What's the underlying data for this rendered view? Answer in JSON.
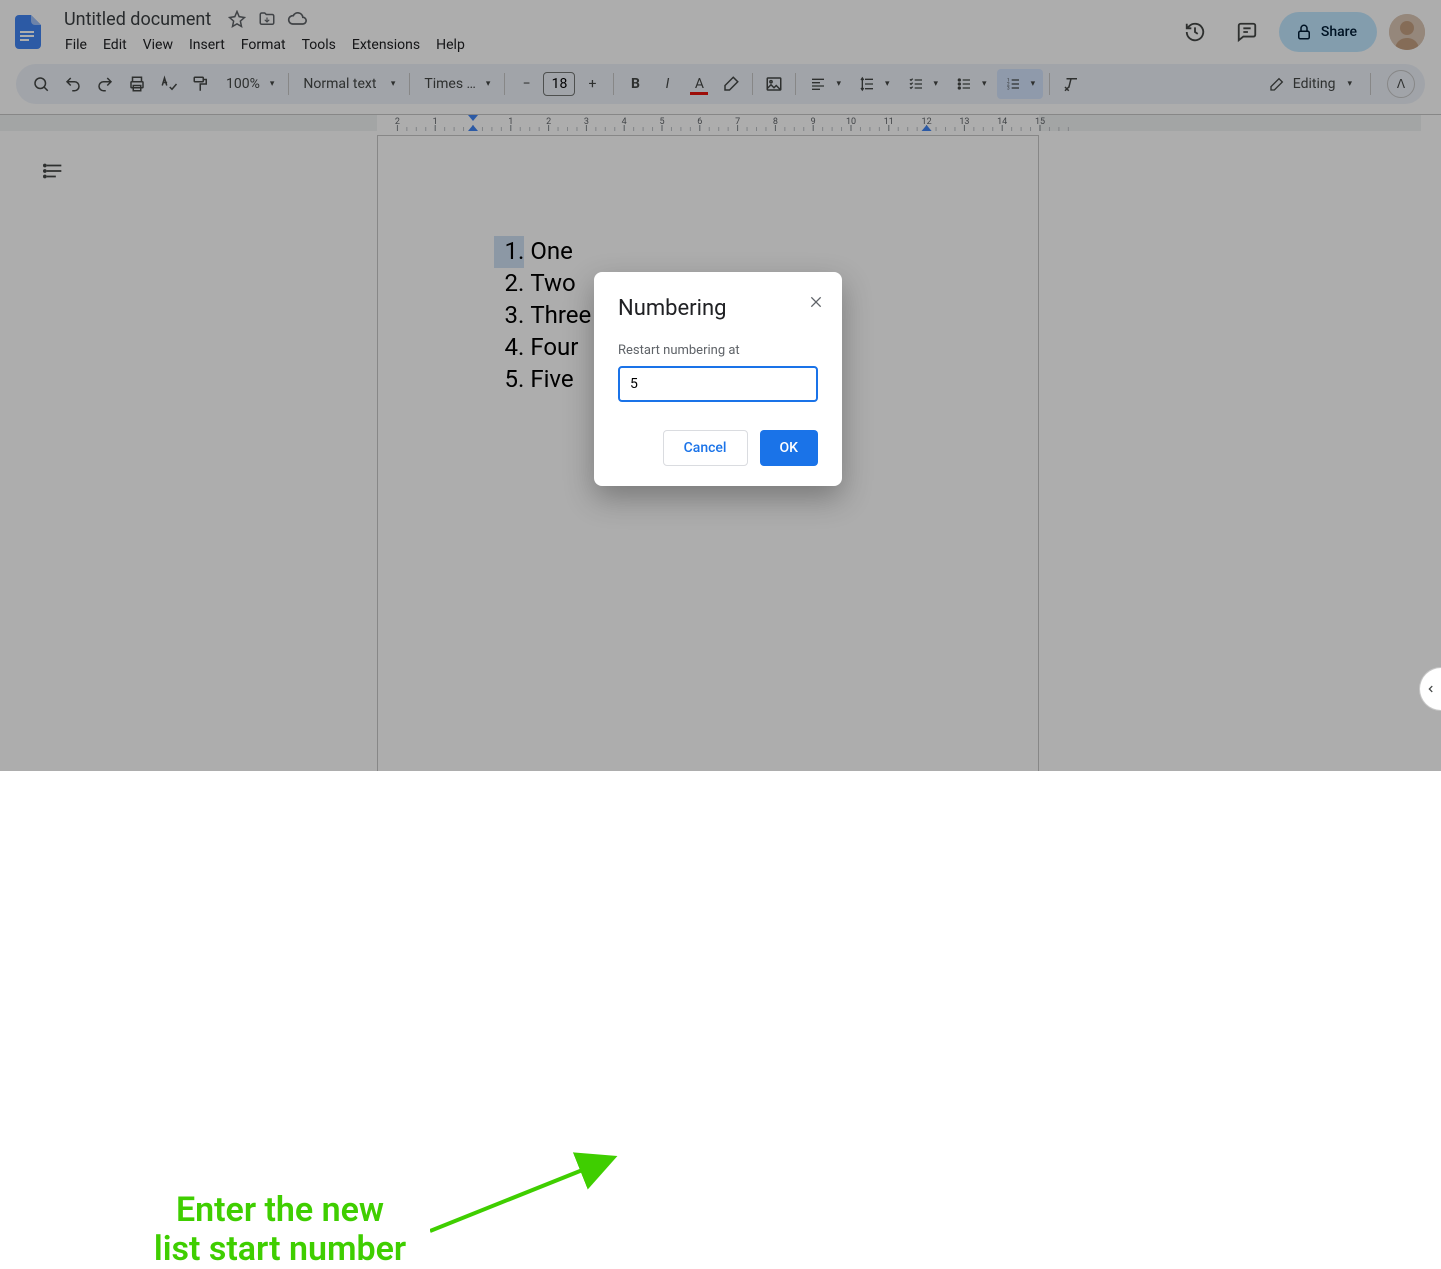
{
  "doc": {
    "title": "Untitled document"
  },
  "menubar": [
    "File",
    "Edit",
    "View",
    "Insert",
    "Format",
    "Tools",
    "Extensions",
    "Help"
  ],
  "share": {
    "label": "Share"
  },
  "toolbar": {
    "zoom": "100%",
    "style": "Normal text",
    "font": "Times …",
    "font_size": "18",
    "editing": "Editing"
  },
  "ruler": {
    "h_labels": [
      "2",
      "1",
      "",
      "1",
      "2",
      "3",
      "4",
      "5",
      "6",
      "7",
      "8",
      "9",
      "10",
      "11",
      "12",
      "13",
      "14",
      "15"
    ]
  },
  "list": [
    {
      "n": "1.",
      "t": "One"
    },
    {
      "n": "2.",
      "t": "Two"
    },
    {
      "n": "3.",
      "t": "Three"
    },
    {
      "n": "4.",
      "t": "Four"
    },
    {
      "n": "5.",
      "t": "Five"
    }
  ],
  "dialog": {
    "title": "Numbering",
    "field_label": "Restart numbering at",
    "value": "5",
    "cancel": "Cancel",
    "ok": "OK"
  },
  "annotation": {
    "line1": "Enter the new",
    "line2": "list start number"
  }
}
